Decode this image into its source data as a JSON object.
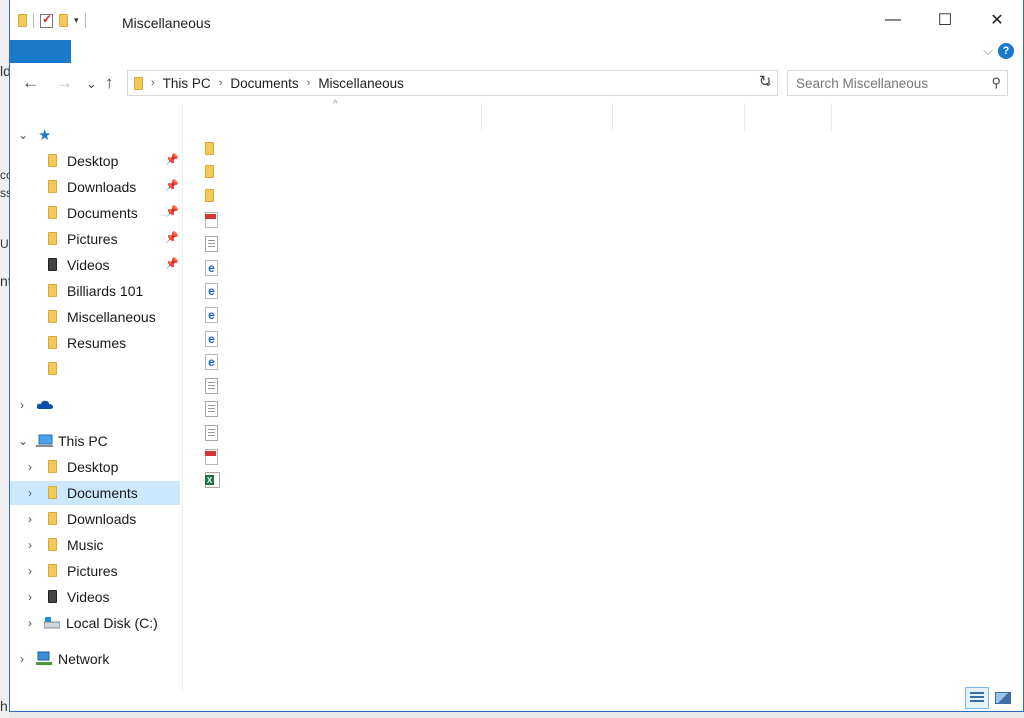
{
  "background": {
    "fragments": [
      "ld",
      "cc",
      "ss",
      "U",
      "nt",
      "h"
    ]
  },
  "window": {
    "title": "Miscellaneous",
    "controls": {
      "minimize": "—",
      "maximize": "☐",
      "close": "✕"
    }
  },
  "quick_access_toolbar": {
    "icons": [
      "folder-icon",
      "properties-icon",
      "new-folder-icon"
    ],
    "dropdown": "▾"
  },
  "ribbon": {
    "file_tab_color": "#1979ca",
    "expand_glyph": "⌵",
    "help_glyph": "?"
  },
  "address": {
    "back": "←",
    "forward": "→",
    "recent": "⌄",
    "up": "↑",
    "breadcrumbs": [
      "This PC",
      "Documents",
      "Miscellaneous"
    ],
    "separator": "›",
    "dropdown": "⌄",
    "refresh": "↻",
    "search_placeholder": "Search Miscellaneous",
    "search_icon": "⚲"
  },
  "nav": {
    "quick_access": {
      "chevron": "⌄",
      "icon": "★",
      "icon_color": "#1979ca"
    },
    "quick_items": [
      {
        "label": "Desktop",
        "icon": "desktop-folder-icon",
        "pinned": true
      },
      {
        "label": "Downloads",
        "icon": "downloads-folder-icon",
        "pinned": true
      },
      {
        "label": "Documents",
        "icon": "documents-folder-icon",
        "pinned": true
      },
      {
        "label": "Pictures",
        "icon": "pictures-folder-icon",
        "pinned": true
      },
      {
        "label": "Videos",
        "icon": "videos-folder-icon",
        "pinned": true
      },
      {
        "label": "Billiards 101",
        "icon": "folder-icon",
        "pinned": false
      },
      {
        "label": "Miscellaneous",
        "icon": "folder-icon",
        "pinned": false
      },
      {
        "label": "Resumes",
        "icon": "folder-icon",
        "pinned": false
      },
      {
        "label": "",
        "icon": "folder-icon",
        "pinned": false
      }
    ],
    "pin_glyph": "📌",
    "onedrive": {
      "chevron": "›",
      "icon": "onedrive-cloud-icon"
    },
    "this_pc": {
      "chevron": "⌄",
      "label": "This PC"
    },
    "pc_items": [
      {
        "label": "Desktop",
        "icon": "desktop-folder-icon"
      },
      {
        "label": "Documents",
        "icon": "documents-folder-icon",
        "selected": true
      },
      {
        "label": "Downloads",
        "icon": "downloads-folder-icon"
      },
      {
        "label": "Music",
        "icon": "music-folder-icon"
      },
      {
        "label": "Pictures",
        "icon": "pictures-folder-icon"
      },
      {
        "label": "Videos",
        "icon": "videos-folder-icon"
      },
      {
        "label": "Local Disk (C:)",
        "icon": "local-disk-icon"
      }
    ],
    "network": {
      "chevron": "›",
      "label": "Network"
    },
    "selection_color": "#cce8ff"
  },
  "content": {
    "sort_caret": "^",
    "files": [
      "folder",
      "folder",
      "folder",
      "pdf",
      "doc",
      "ie",
      "ie",
      "ie",
      "ie",
      "ie",
      "doc",
      "doc",
      "doc",
      "pdf",
      "xls"
    ]
  },
  "statusbar": {
    "views": [
      "details-view",
      "large-icons-view"
    ],
    "active_view": "details-view"
  }
}
